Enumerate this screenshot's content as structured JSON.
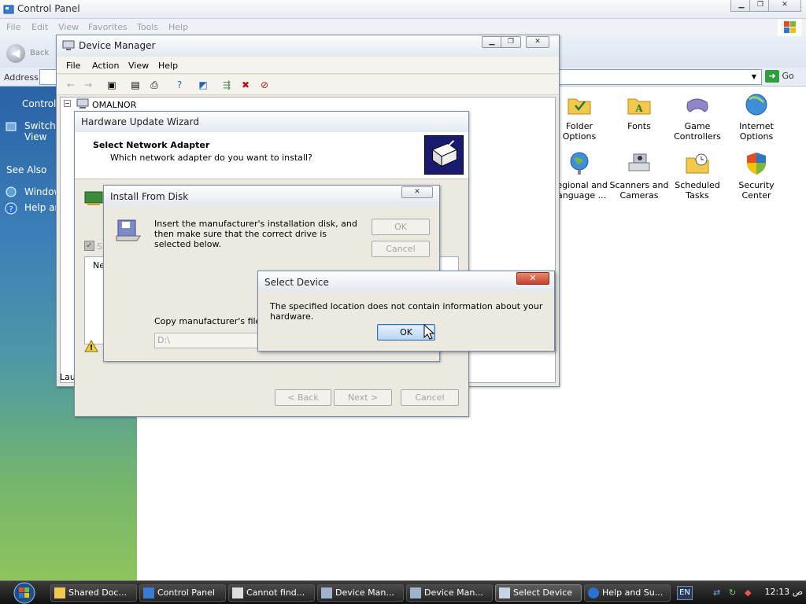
{
  "control_panel": {
    "title": "Control Panel",
    "menu": [
      "File",
      "Edit",
      "View",
      "Favorites",
      "Tools",
      "Help"
    ],
    "back_label": "Back",
    "address_label": "Address",
    "go_label": "Go",
    "left": {
      "control_text": "Control",
      "switch_view_line1": "Switch",
      "switch_view_line2": "View",
      "see_also": "See Also",
      "windows_update": "Window",
      "help": "Help an"
    },
    "icons": [
      {
        "label": "Folder Options",
        "icon": "folder-options-icon"
      },
      {
        "label": "Fonts",
        "icon": "fonts-icon"
      },
      {
        "label": "Game Controllers",
        "icon": "game-controllers-icon"
      },
      {
        "label": "Internet Options",
        "icon": "internet-options-icon"
      },
      {
        "label": "Regional and Language ...",
        "icon": "regional-language-icon"
      },
      {
        "label": "Scanners and Cameras",
        "icon": "scanners-cameras-icon"
      },
      {
        "label": "Scheduled Tasks",
        "icon": "scheduled-tasks-icon"
      },
      {
        "label": "Security Center",
        "icon": "security-center-icon"
      }
    ]
  },
  "device_manager": {
    "title": "Device Manager",
    "menu": [
      "File",
      "Action",
      "View",
      "Help"
    ],
    "tree_root": "OMALNOR",
    "status_text": "Lau"
  },
  "wizard": {
    "title": "Hardware Update Wizard",
    "heading": "Select Network Adapter",
    "subheading": "Which network adapter do you want to install?",
    "back_button": "< Back",
    "next_button": "Next >",
    "cancel_button": "Cancel",
    "partial_label_s": "S",
    "partial_label_ne": "Ne"
  },
  "install_from_disk": {
    "title": "Install From Disk",
    "message": "Insert the manufacturer's installation disk, and then make sure that the correct drive is selected below.",
    "ok_button": "OK",
    "cancel_button": "Cancel",
    "copy_label": "Copy manufacturer's files fro",
    "path_value": "D:\\"
  },
  "select_device": {
    "title": "Select Device",
    "message": "The specified location does not contain information about your hardware.",
    "ok_button": "OK",
    "close_glyph": "✕"
  },
  "taskbar": {
    "tasks": [
      {
        "label": "Shared Doc...",
        "icon": "folder-icon"
      },
      {
        "label": "Control Panel",
        "icon": "control-panel-icon"
      },
      {
        "label": "Cannot find...",
        "icon": "document-icon"
      },
      {
        "label": "Device Man...",
        "icon": "device-manager-icon"
      },
      {
        "label": "Device Man...",
        "icon": "device-manager-icon"
      },
      {
        "label": "Select Device",
        "icon": "select-device-icon",
        "active": true
      },
      {
        "label": "Help and Su...",
        "icon": "help-icon"
      }
    ],
    "language": "EN",
    "clock": "12:13 ص"
  },
  "colors": {
    "taskbar": "#1a1a1a",
    "cp_left_top": "#2a63a7",
    "cp_left_bottom": "#8fc45c",
    "close_button": "#c6422a",
    "ok_button_focus": "#b8d4f2"
  }
}
